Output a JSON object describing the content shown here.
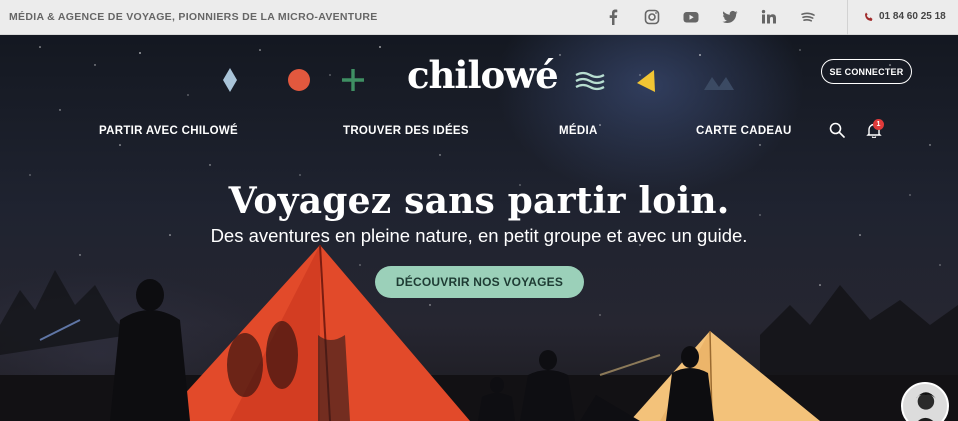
{
  "topbar": {
    "tagline": "MÉDIA & AGENCE DE VOYAGE, PIONNIERS DE LA MICRO-AVENTURE",
    "socials": [
      "facebook-icon",
      "instagram-icon",
      "youtube-icon",
      "twitter-icon",
      "linkedin-icon",
      "spotify-icon"
    ],
    "phone": "01 84 60 25 18"
  },
  "header": {
    "logo": "chilowé",
    "login": "SE CONNECTER",
    "nav": [
      "PARTIR AVEC CHILOWÉ",
      "TROUVER DES IDÉES",
      "MÉDIA",
      "CARTE CADEAU"
    ],
    "notification_count": "1"
  },
  "hero": {
    "title": "Voyagez sans partir loin.",
    "subtitle": "Des aventures en pleine nature, en petit groupe et avec un guide.",
    "cta": "DÉCOUVRIR NOS VOYAGES"
  },
  "colors": {
    "diamond": "#a9c4d8",
    "circle": "#e2583e",
    "plus": "#3f8f63",
    "waves": "#b7ddd0",
    "triangle": "#f2c533",
    "mountains": "#3b4a63",
    "cta": "#9bd0b9",
    "tent_red": "#e24a2a",
    "tent_warm": "#f3c27a",
    "badge": "#e03a3a"
  }
}
